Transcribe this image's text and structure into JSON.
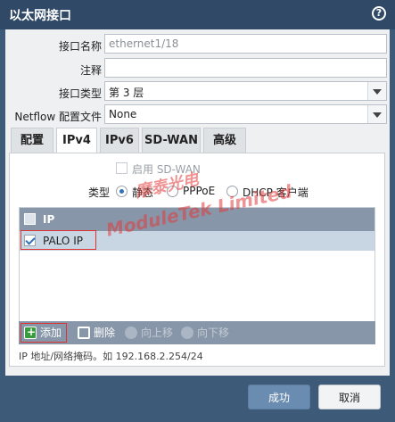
{
  "dialog": {
    "title": "以太网接口",
    "help_icon": "?"
  },
  "form": {
    "name_label": "接口名称",
    "name_value": "ethernet1/18",
    "comment_label": "注释",
    "comment_value": "",
    "type_label": "接口类型",
    "type_value": "第 3 层",
    "netflow_label": "Netflow 配置文件",
    "netflow_value": "None"
  },
  "tabs": [
    {
      "label": "配置",
      "active": false
    },
    {
      "label": "IPv4",
      "active": true
    },
    {
      "label": "IPv6",
      "active": false
    },
    {
      "label": "SD-WAN",
      "active": false
    },
    {
      "label": "高级",
      "active": false
    }
  ],
  "ipv4": {
    "enable_sdwan_label": "启用 SD-WAN",
    "type_label": "类型",
    "type_options": [
      {
        "label": "静态",
        "selected": true
      },
      {
        "label": "PPPoE",
        "selected": false
      },
      {
        "label": "DHCP 客户端",
        "selected": false
      }
    ],
    "table": {
      "header": "IP",
      "rows": [
        {
          "value": "PALO IP",
          "checked": true
        }
      ]
    },
    "footer": {
      "add": "添加",
      "delete": "删除",
      "move_up": "向上移",
      "move_down": "向下移"
    },
    "hint": "IP 地址/网络掩码。如 192.168.2.254/24"
  },
  "watermark": {
    "line1": "摩泰光电",
    "line2": "ModuleTek Limited"
  },
  "buttons": {
    "ok": "成功",
    "cancel": "取消"
  }
}
